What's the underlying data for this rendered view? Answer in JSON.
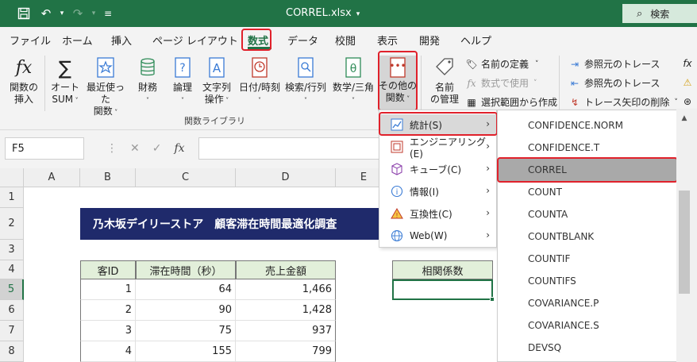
{
  "titlebar": {
    "title": "CORREL.xlsx",
    "search_label": "検索"
  },
  "menu_tabs": [
    "ファイル",
    "ホーム",
    "挿入",
    "ページ レイアウト",
    "数式",
    "データ",
    "校閲",
    "表示",
    "開発",
    "ヘルプ"
  ],
  "ribbon": {
    "insert_function": [
      "関数の",
      "挿入"
    ],
    "autosum": [
      "オート",
      "SUM"
    ],
    "recent": [
      "最近使った",
      "関数"
    ],
    "financial": "財務",
    "logical": "論理",
    "text": [
      "文字列",
      "操作"
    ],
    "datetime": "日付/時刻",
    "lookup": "検索/行列",
    "math": "数学/三角",
    "more": [
      "その他の",
      "関数"
    ],
    "name_manager": [
      "名前",
      "の管理"
    ],
    "define_name": "名前の定義",
    "use_in_formula": "数式で使用",
    "create_from_selection": "選択範囲から作成",
    "trace_precedents": "参照元のトレース",
    "trace_dependents": "参照先のトレース",
    "remove_arrows": "トレース矢印の削除",
    "group_label": "関数ライブラリ"
  },
  "formula_bar": {
    "name_box": "F5",
    "fx": "fx"
  },
  "sheet": {
    "columns": [
      "A",
      "B",
      "C",
      "D",
      "E"
    ],
    "rows": [
      "1",
      "2",
      "3",
      "4",
      "5",
      "6",
      "7",
      "8"
    ],
    "banner": "乃木坂デイリーストア　顧客滞在時間最適化調査",
    "headers": [
      "客ID",
      "滞在時間（秒）",
      "売上金額"
    ],
    "data": [
      [
        "1",
        "64",
        "1,466"
      ],
      [
        "2",
        "90",
        "1,428"
      ],
      [
        "3",
        "75",
        "937"
      ],
      [
        "4",
        "155",
        "799"
      ]
    ],
    "corr_header": "相関係数"
  },
  "submenu": [
    {
      "label": "統計(S)"
    },
    {
      "label": "エンジニアリング(E)"
    },
    {
      "label": "キューブ(C)"
    },
    {
      "label": "情報(I)"
    },
    {
      "label": "互換性(C)"
    },
    {
      "label": "Web(W)"
    }
  ],
  "functions": [
    "CONFIDENCE.NORM",
    "CONFIDENCE.T",
    "CORREL",
    "COUNT",
    "COUNTA",
    "COUNTBLANK",
    "COUNTIF",
    "COUNTIFS",
    "COVARIANCE.P",
    "COVARIANCE.S",
    "DEVSQ"
  ],
  "colors": {
    "excel_green": "#217346",
    "highlight_red": "#e0212b",
    "banner": "#1f2a6b",
    "header_fill": "#e2efda"
  }
}
